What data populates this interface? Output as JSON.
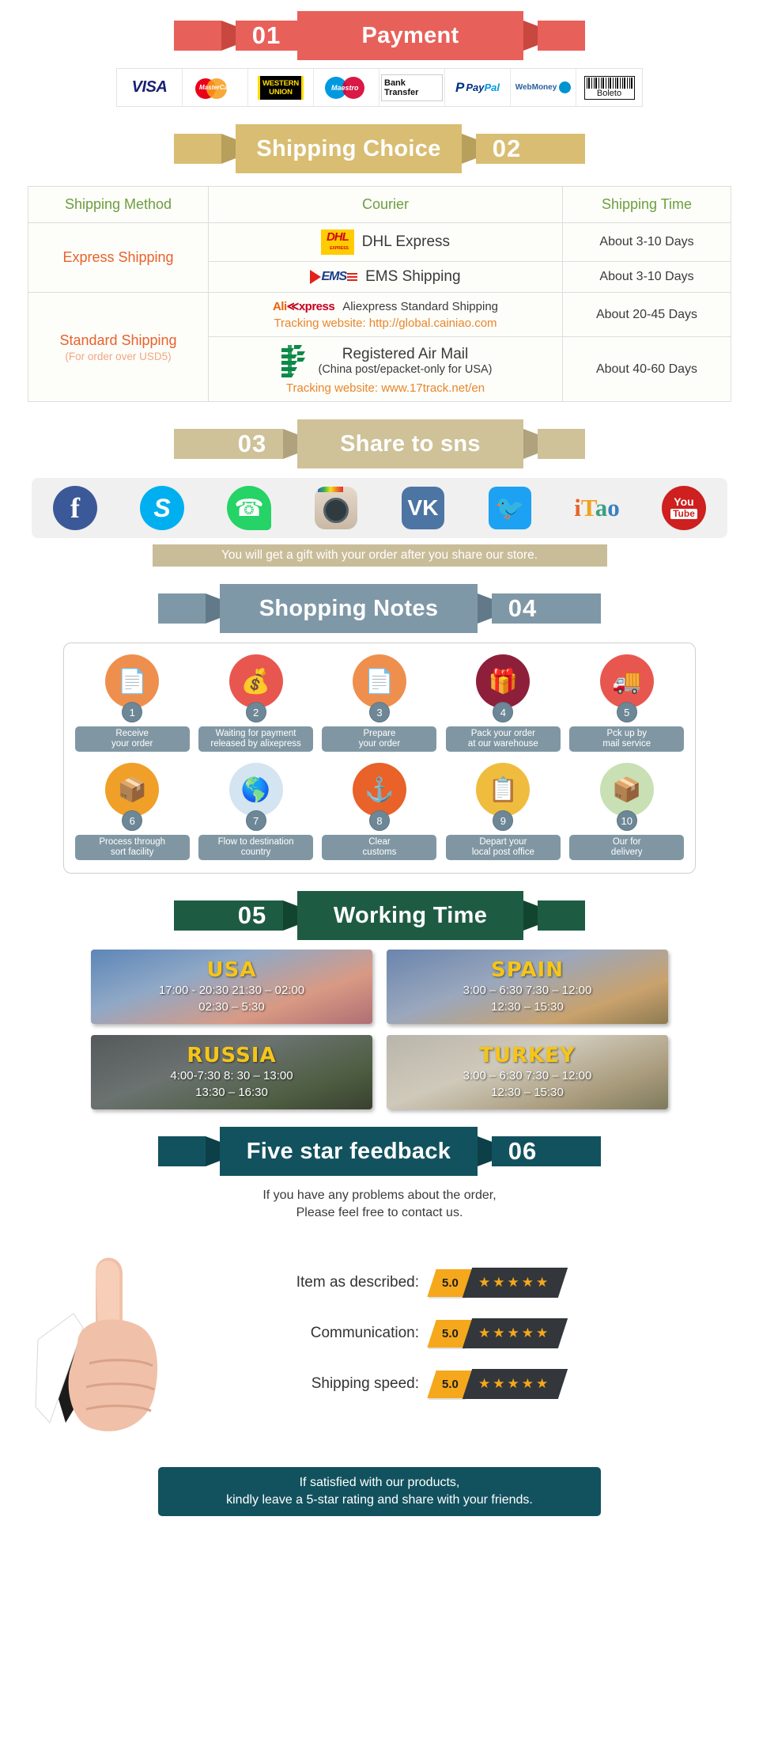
{
  "sections": {
    "payment": {
      "number": "01",
      "title": "Payment",
      "accent": "#e8605a",
      "methods": [
        {
          "name": "visa-logo",
          "label": "VISA"
        },
        {
          "name": "mastercard-logo",
          "label": "MasterCard"
        },
        {
          "name": "western-union-logo",
          "label": "WESTERN UNION"
        },
        {
          "name": "maestro-logo",
          "label": "Maestro"
        },
        {
          "name": "bank-transfer-logo",
          "label": "Bank Transfer"
        },
        {
          "name": "paypal-logo",
          "label": "PayPal"
        },
        {
          "name": "webmoney-logo",
          "label": "WebMoney"
        },
        {
          "name": "boleto-logo",
          "label": "Boleto"
        }
      ]
    },
    "shipping": {
      "number": "02",
      "title": "Shipping Choice",
      "accent": "#d9bd72",
      "table": {
        "headers": [
          "Shipping Method",
          "Courier",
          "Shipping Time"
        ],
        "groups": [
          {
            "method": "Express Shipping",
            "method_sub": "",
            "rows": [
              {
                "logo": "dhl-logo",
                "courier": "DHL Express",
                "courier_sub": "",
                "tracking": "",
                "time": "About 3-10 Days"
              },
              {
                "logo": "ems-logo",
                "courier": "EMS Shipping",
                "courier_sub": "",
                "tracking": "",
                "time": "About 3-10 Days"
              }
            ]
          },
          {
            "method": "Standard Shipping",
            "method_sub": "(For order over USD5)",
            "rows": [
              {
                "logo": "aliexpress-logo",
                "courier": "Aliexpress Standard Shipping",
                "courier_sub": "",
                "tracking": "Tracking website: http://global.cainiao.com",
                "time": "About 20-45 Days"
              },
              {
                "logo": "china-post-logo",
                "courier": "Registered Air Mail",
                "courier_sub": "(China post/epacket-only for USA)",
                "tracking": "Tracking website: www.17track.net/en",
                "time": "About 40-60 Days"
              }
            ]
          }
        ]
      }
    },
    "share": {
      "number": "03",
      "title": "Share to sns",
      "accent": "#cfc198",
      "networks": [
        {
          "name": "facebook-icon",
          "label": "Facebook"
        },
        {
          "name": "skype-icon",
          "label": "Skype"
        },
        {
          "name": "whatsapp-icon",
          "label": "WhatsApp"
        },
        {
          "name": "instagram-icon",
          "label": "Instagram"
        },
        {
          "name": "vk-icon",
          "label": "VK"
        },
        {
          "name": "twitter-icon",
          "label": "Twitter"
        },
        {
          "name": "itao-icon",
          "label": "iTao"
        },
        {
          "name": "youtube-icon",
          "label": "YouTube"
        }
      ],
      "note": "You will get a gift with your order after you share our store."
    },
    "notes": {
      "number": "04",
      "title": "Shopping Notes",
      "accent": "#7f98a7",
      "steps": [
        {
          "num": "1",
          "label": "Receive\nyour order",
          "icon": "document-icon",
          "color": "#ef8f4e"
        },
        {
          "num": "2",
          "label": "Waiting for payment\nreleased by alixepress",
          "icon": "money-bag-icon",
          "color": "#e8574f"
        },
        {
          "num": "3",
          "label": "Prepare\nyour order",
          "icon": "document-icon",
          "color": "#ef8f4e"
        },
        {
          "num": "4",
          "label": "Pack your order\nat our warehouse",
          "icon": "gift-box-icon",
          "color": "#8e1f3a"
        },
        {
          "num": "5",
          "label": "Pck up by\nmail service",
          "icon": "mail-truck-icon",
          "color": "#e8574f"
        },
        {
          "num": "6",
          "label": "Process through\nsort facility",
          "icon": "sorting-icon",
          "color": "#f0a028"
        },
        {
          "num": "7",
          "label": "Flow to destination\ncountry",
          "icon": "globe-icon",
          "color": "#d4e4f0"
        },
        {
          "num": "8",
          "label": "Clear\ncustoms",
          "icon": "anchor-icon",
          "color": "#e8622a"
        },
        {
          "num": "9",
          "label": "Depart your\nlocal post office",
          "icon": "clipboard-icon",
          "color": "#f0bc3e"
        },
        {
          "num": "10",
          "label": "Our for\ndelivery",
          "icon": "package-icon",
          "color": "#c8e0b4"
        }
      ]
    },
    "working_time": {
      "number": "05",
      "title": "Working Time",
      "accent": "#1d5c43",
      "cities": [
        {
          "name": "USA",
          "theme": "wt-usa",
          "lines": [
            "17:00 - 20:30  21:30 – 02:00",
            "02:30 – 5:30"
          ]
        },
        {
          "name": "SPAIN",
          "theme": "wt-spain",
          "lines": [
            "3:00 – 6:30   7:30 – 12:00",
            "12:30 – 15:30"
          ]
        },
        {
          "name": "RUSSIA",
          "theme": "wt-russia",
          "lines": [
            "4:00-7:30   8: 30 – 13:00",
            "13:30 – 16:30"
          ]
        },
        {
          "name": "TURKEY",
          "theme": "wt-turkey",
          "lines": [
            "3:00 – 6:30   7:30 – 12:00",
            "12:30 – 15:30"
          ]
        }
      ]
    },
    "feedback": {
      "number": "06",
      "title": "Five star feedback",
      "accent": "#12525e",
      "intro_line1": "If you have any problems about the order,",
      "intro_line2": "Please feel free to contact us.",
      "ratings": [
        {
          "label": "Item as described:",
          "score": "5.0",
          "stars": "★★★★★"
        },
        {
          "label": "Communication:",
          "score": "5.0",
          "stars": "★★★★★"
        },
        {
          "label": "Shipping speed:",
          "score": "5.0",
          "stars": "★★★★★"
        }
      ],
      "footer_line1": "If satisfied with our products,",
      "footer_line2": "kindly leave a 5-star rating and share with your friends."
    }
  }
}
